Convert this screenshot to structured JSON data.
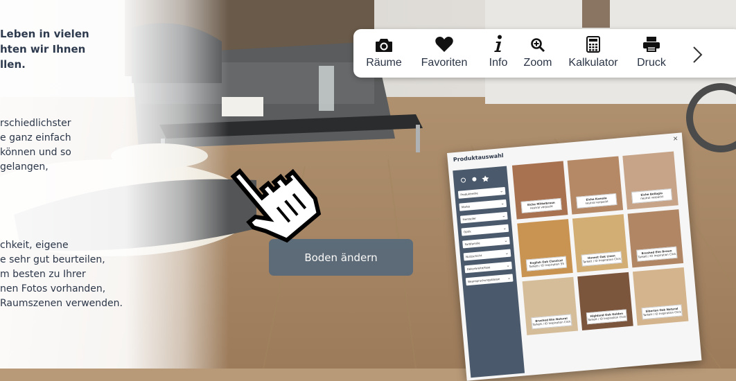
{
  "intro": {
    "headline": "Leben in vielen\nhten wir Ihnen\nllen.",
    "para1": "rschiedlichster\ne ganz einfach\nkönnen und so\ngelangen,",
    "para2": "chkeit, eigene\ne sehr gut beurteilen,\nm besten zu Ihrer\nnen Fotos vorhanden,\nRaumszenen verwenden."
  },
  "toolbar": {
    "items": [
      {
        "label": "Räume",
        "icon": "camera-icon"
      },
      {
        "label": "Favoriten",
        "icon": "heart-icon"
      },
      {
        "label": "Info",
        "icon": "info-icon"
      },
      {
        "label": "Zoom",
        "icon": "zoom-in-icon"
      },
      {
        "label": "Kalkulator",
        "icon": "calculator-icon"
      },
      {
        "label": "Druck",
        "icon": "printer-icon"
      }
    ],
    "next_icon": "chevron-right-icon"
  },
  "tooltip": {
    "text": "Boden ändern"
  },
  "product_window": {
    "title": "Produktauswahl",
    "swatches": [
      {
        "name": "Eiche Mittelbraun",
        "sub": "neutral verpackt",
        "color": "#a87150"
      },
      {
        "name": "Eiche Kamala",
        "sub": "neutral verpackt",
        "color": "#b58866"
      },
      {
        "name": "Eiche Bellagio",
        "sub": "neutral verpackt",
        "color": "#c7a487"
      },
      {
        "name": "English Oak Classical",
        "sub": "Tarkett / ID Inspiration 55",
        "color": "#c99452"
      },
      {
        "name": "Honest Oak Linen",
        "sub": "Tarkett / ID Inspiration Click",
        "color": "#d2ad74"
      },
      {
        "name": "Brushed Elm Brown",
        "sub": "Tarkett / ID Inspiration Click",
        "color": "#b08664"
      },
      {
        "name": "Brushed Elm Natural",
        "sub": "Tarkett / ID Inspiration Click",
        "color": "#d6bd9a"
      },
      {
        "name": "Highland Oak Golden",
        "sub": "Tarkett / ID Inspiration Click",
        "color": "#7c553d"
      },
      {
        "name": "Siberian Oak Natural",
        "sub": "Tarkett / ID Inspiration Click",
        "color": "#d4b48c"
      }
    ],
    "filters": [
      "Produktreihe",
      "Marke",
      "Hersteller",
      "Optik",
      "Farbfamilie",
      "Nutzschicht",
      "Dekorbreite/Fase",
      "Beanspruchungsklasse"
    ]
  }
}
